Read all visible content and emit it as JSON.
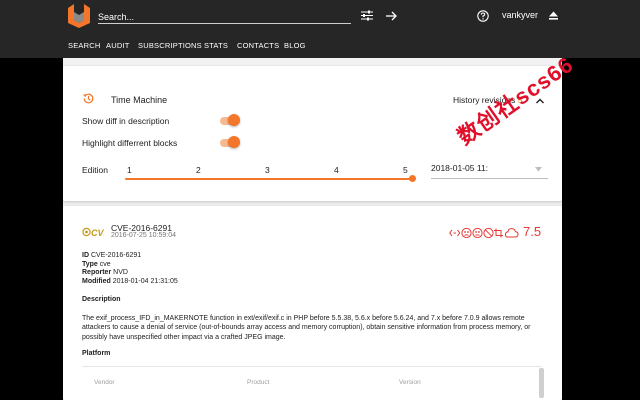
{
  "header": {
    "search_placeholder": "Search...",
    "username": "vankyver"
  },
  "nav": {
    "items": [
      "SEARCH",
      "AUDIT",
      "SUBSCRIPTIONS",
      "STATS",
      "CONTACTS",
      "BLOG"
    ]
  },
  "time_machine": {
    "title": "Time Machine",
    "history_label": "History revisions",
    "history_count": "5",
    "show_diff_label": "Show diff in description",
    "highlight_label": "Highlight differrent blocks",
    "show_diff_on": true,
    "highlight_on": true,
    "edition_label": "Edition",
    "editions": [
      "1",
      "2",
      "3",
      "4",
      "5"
    ],
    "selected_edition": 5,
    "selected_date": "2018-01-05 11:"
  },
  "cve": {
    "logo_text": "CVE",
    "id": "CVE-2016-6291",
    "published": "2016-07-25 10:59:04",
    "score": "7.5",
    "id_label": "ID",
    "id_value": "CVE-2016-6291",
    "type_label": "Type",
    "type_value": "cve",
    "reporter_label": "Reporter",
    "reporter_value": "NVD",
    "modified_label": "Modified",
    "modified_value": "2018-01-04 21:31:05",
    "description_heading": "Description",
    "description": "The exif_process_IFD_in_MAKERNOTE function in ext/exif/exif.c in PHP before 5.5.38, 5.6.x before 5.6.24, and 7.x before 7.0.9 allows remote attackers to cause a denial of service (out-of-bounds array access and memory corruption), obtain sensitive information from process memory, or possibly have unspecified other impact via a crafted JPEG image.",
    "platform_heading": "Platform",
    "platform_columns": [
      "Vendor",
      "Product",
      "Version"
    ]
  },
  "watermark": "数创社scs66",
  "colors": {
    "accent": "#f4762a",
    "score": "#e53935",
    "topbar": "#262626"
  }
}
